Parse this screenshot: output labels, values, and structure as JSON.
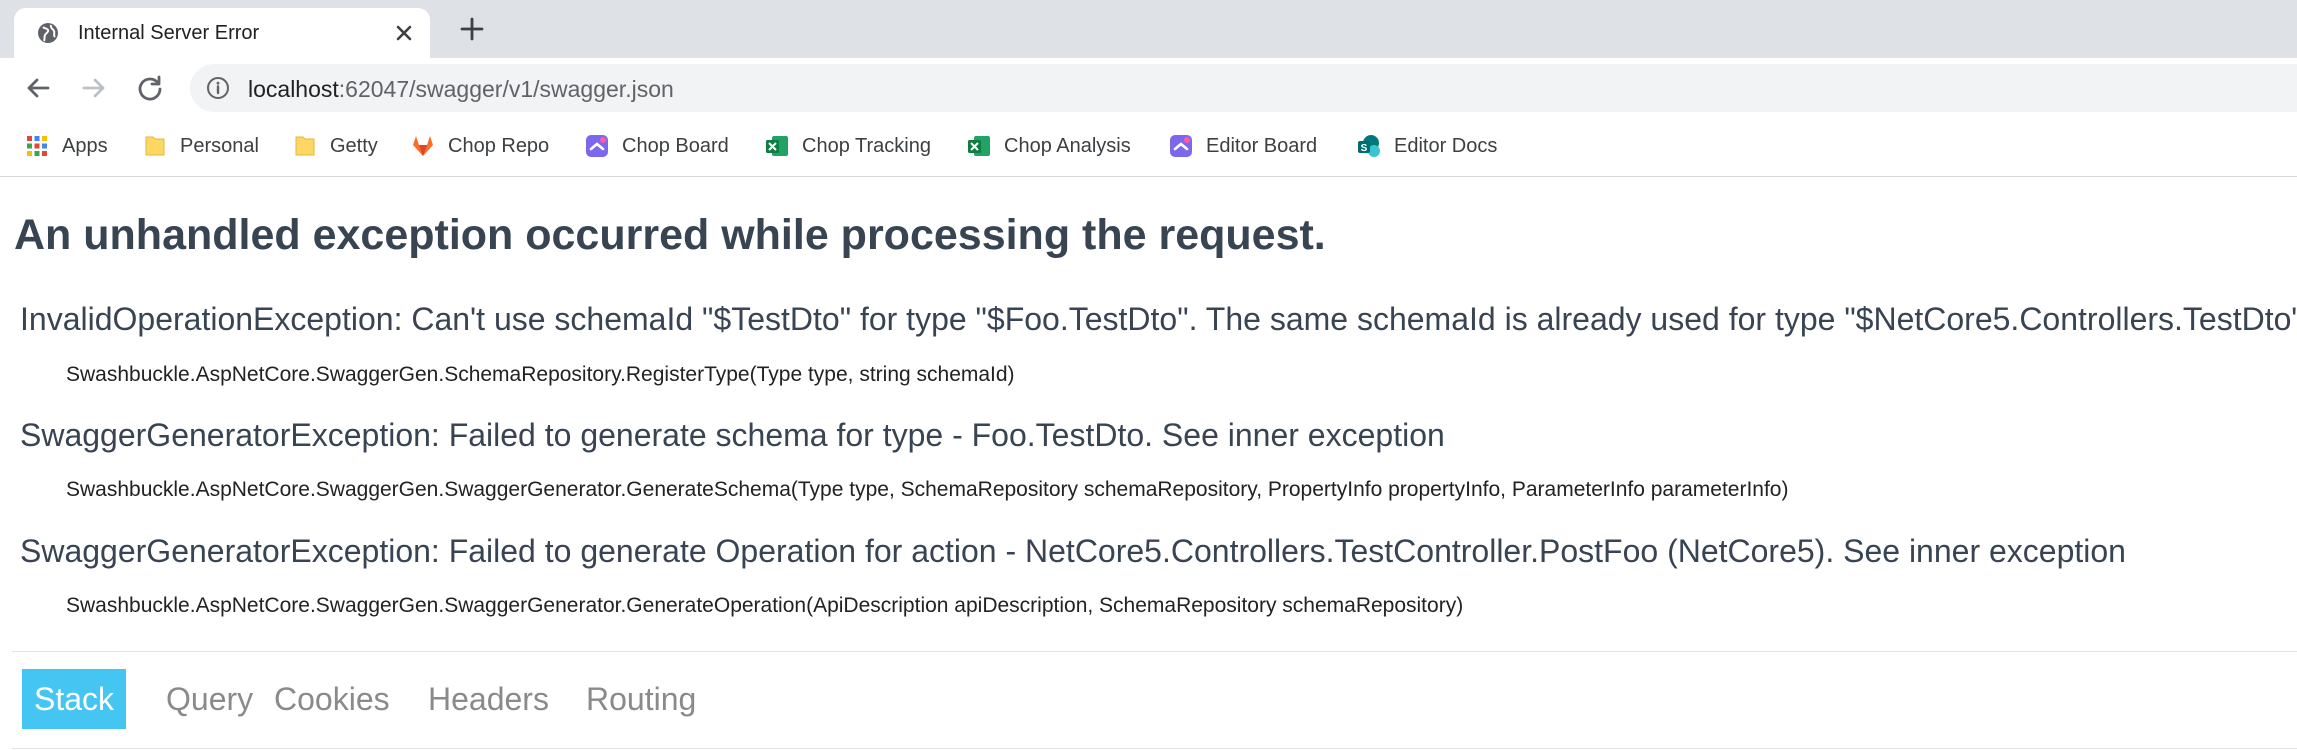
{
  "browser": {
    "tab": {
      "title": "Internal Server Error"
    },
    "address": {
      "host": "localhost",
      "rest": ":62047/swagger/v1/swagger.json"
    },
    "bookmarks": [
      {
        "label": "Apps",
        "icon": "apps-grid-icon"
      },
      {
        "label": "Personal",
        "icon": "folder-icon"
      },
      {
        "label": "Getty",
        "icon": "folder-icon"
      },
      {
        "label": "Chop Repo",
        "icon": "gitlab-icon"
      },
      {
        "label": "Chop Board",
        "icon": "clickup-icon"
      },
      {
        "label": "Chop Tracking",
        "icon": "excel-icon"
      },
      {
        "label": "Chop Analysis",
        "icon": "excel-icon"
      },
      {
        "label": "Editor Board",
        "icon": "clickup-icon"
      },
      {
        "label": "Editor Docs",
        "icon": "sharepoint-icon"
      }
    ]
  },
  "page": {
    "heading": "An unhandled exception occurred while processing the request.",
    "exceptions": [
      {
        "message": "InvalidOperationException: Can't use schemaId \"$TestDto\" for type \"$Foo.TestDto\". The same schemaId is already used for type \"$NetCore5.Controllers.TestDto\"",
        "frame": "Swashbuckle.AspNetCore.SwaggerGen.SchemaRepository.RegisterType(Type type, string schemaId)"
      },
      {
        "message": "SwaggerGeneratorException: Failed to generate schema for type - Foo.TestDto. See inner exception",
        "frame": "Swashbuckle.AspNetCore.SwaggerGen.SwaggerGenerator.GenerateSchema(Type type, SchemaRepository schemaRepository, PropertyInfo propertyInfo, ParameterInfo parameterInfo)"
      },
      {
        "message": "SwaggerGeneratorException: Failed to generate Operation for action - NetCore5.Controllers.TestController.PostFoo (NetCore5). See inner exception",
        "frame": "Swashbuckle.AspNetCore.SwaggerGen.SwaggerGenerator.GenerateOperation(ApiDescription apiDescription, SchemaRepository schemaRepository)"
      }
    ],
    "tabs": [
      "Stack",
      "Query",
      "Cookies",
      "Headers",
      "Routing"
    ],
    "active_tab": "Stack"
  },
  "colors": {
    "heading": "#394453",
    "active_tab": "#44c5f2",
    "tab_strip": "#dee1e6"
  }
}
